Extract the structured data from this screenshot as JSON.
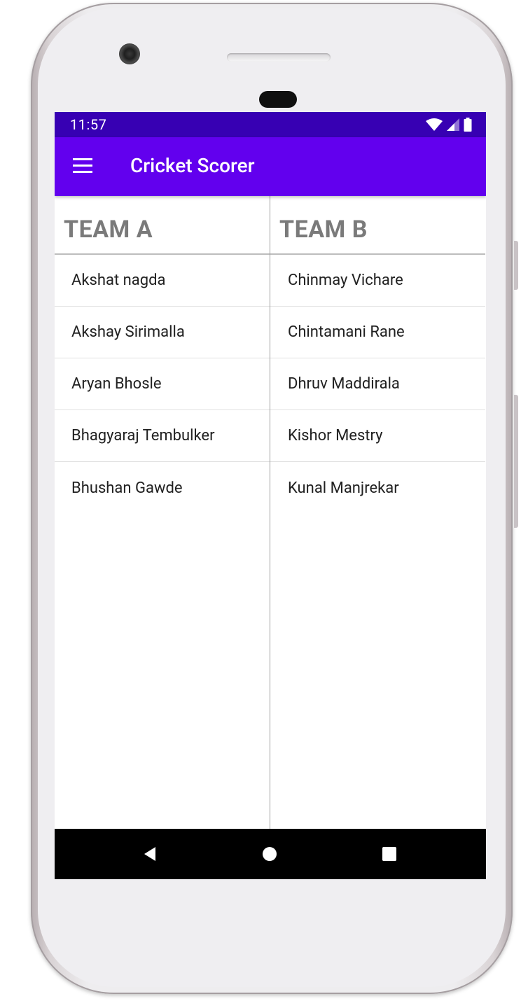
{
  "status_bar": {
    "time": "11:57"
  },
  "app_bar": {
    "title": "Cricket Scorer",
    "menu_icon": "hamburger-menu-icon"
  },
  "teams": [
    {
      "name": "TEAM A",
      "players": [
        "Akshat nagda",
        "Akshay Sirimalla",
        "Aryan Bhosle",
        "Bhagyaraj Tembulker",
        "Bhushan Gawde"
      ]
    },
    {
      "name": "TEAM B",
      "players": [
        "Chinmay Vichare",
        "Chintamani Rane",
        "Dhruv Maddirala",
        "Kishor Mestry",
        "Kunal Manjrekar"
      ]
    }
  ],
  "nav_bar": {
    "back_icon": "back-triangle-icon",
    "home_icon": "home-circle-icon",
    "recents_icon": "recents-square-icon"
  },
  "colors": {
    "status_bar": "#3700b3",
    "app_bar": "#6200ee",
    "team_header_text": "#7a7a7a",
    "player_text": "#212121"
  }
}
